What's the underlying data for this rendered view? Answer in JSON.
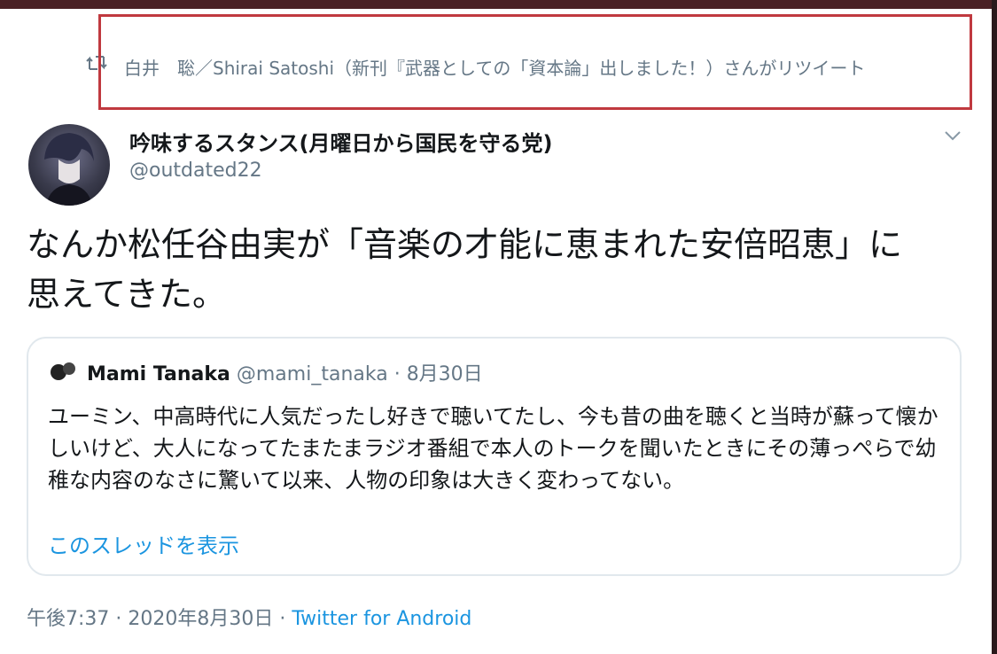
{
  "retweet": {
    "text": "白井　聡／Shirai Satoshi（新刊『武器としての「資本論」出しました！）さんがリツイート",
    "icon": "retweet-icon"
  },
  "tweet": {
    "display_name": "吟味するスタンス(月曜日から国民を守る党)",
    "handle": "@outdated22",
    "text": "なんか松任谷由実が「音楽の才能に恵まれた安倍昭恵」に思えてきた。",
    "timestamp": "午後7:37 · 2020年8月30日 · ",
    "source": "Twitter for Android"
  },
  "quote": {
    "name": "Mami Tanaka",
    "handle": "@mami_tanaka",
    "separator": " · ",
    "date": "8月30日",
    "text": "ユーミン、中高時代に人気だったし好きで聴いてたし、今も昔の曲を聴くと当時が蘇って懐かしいけど、大人になってたまたまラジオ番組で本人のトークを聞いたときにその薄っぺらで幼稚な内容のなさに驚いて以来、人物の印象は大きく変わってない。",
    "thread_link": "このスレッドを表示"
  },
  "colors": {
    "highlight_border": "#c0393f",
    "link": "#1b95e0",
    "secondary_text": "#657786"
  }
}
